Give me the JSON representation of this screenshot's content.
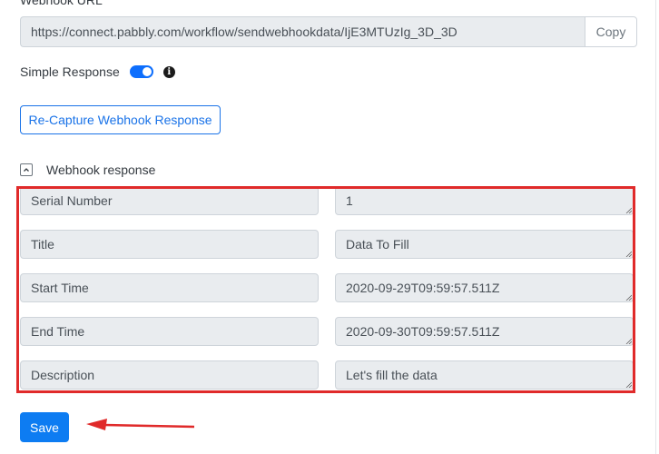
{
  "webhook_url": {
    "label": "Webhook URL",
    "value": "https://connect.pabbly.com/workflow/sendwebhookdata/IjE3MTUzIg_3D_3D",
    "copy_label": "Copy"
  },
  "simple_response": {
    "label": "Simple Response",
    "enabled": true,
    "info_icon": "info-circle-icon"
  },
  "recapture_button": {
    "label": "Re-Capture Webhook Response"
  },
  "webhook_response": {
    "label": "Webhook response",
    "collapse_icon": "chevron-up-icon",
    "fields": [
      {
        "key": "Serial Number",
        "value": "1"
      },
      {
        "key": "Title",
        "value": "Data To Fill"
      },
      {
        "key": "Start Time",
        "value": "2020-09-29T09:59:57.511Z"
      },
      {
        "key": "End Time",
        "value": "2020-09-30T09:59:57.511Z"
      },
      {
        "key": "Description",
        "value": "Let's fill the data"
      }
    ]
  },
  "save_button": {
    "label": "Save"
  },
  "annotations": {
    "highlight_color": "#e02a2a",
    "arrow_color": "#e02a2a"
  },
  "colors": {
    "primary": "#0d7cf2",
    "outline_primary": "#1a73e8",
    "input_bg": "#e9ecef"
  }
}
